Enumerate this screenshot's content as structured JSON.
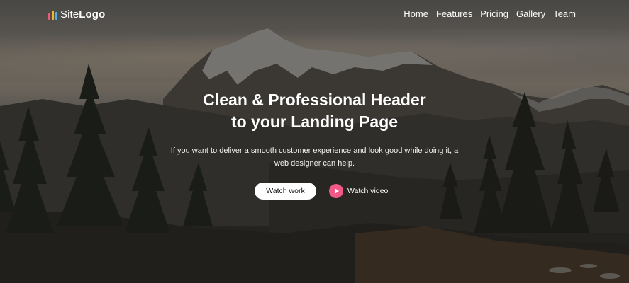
{
  "brand": {
    "logo_prefix": "Site",
    "logo_strong": "Logo",
    "logo_colors": [
      "#f0588a",
      "#f5b72a",
      "#4fb3e8"
    ]
  },
  "nav": {
    "items": [
      {
        "label": "Home"
      },
      {
        "label": "Features"
      },
      {
        "label": "Pricing"
      },
      {
        "label": "Gallery"
      },
      {
        "label": "Team"
      }
    ]
  },
  "hero": {
    "title_line1": "Clean & Professional Header",
    "title_line2": "to your Landing Page",
    "subtitle_line1": "If you want to deliver a smooth customer experience and look good while doing it, a",
    "subtitle_line2": "web designer can help.",
    "primary_button": "Watch work",
    "video_link": "Watch video"
  },
  "colors": {
    "accent": "#f0588a",
    "button_bg": "#ffffff",
    "text": "#ffffff"
  },
  "icons": {
    "logo": "bar-chart-logo-icon",
    "video": "play-icon"
  }
}
